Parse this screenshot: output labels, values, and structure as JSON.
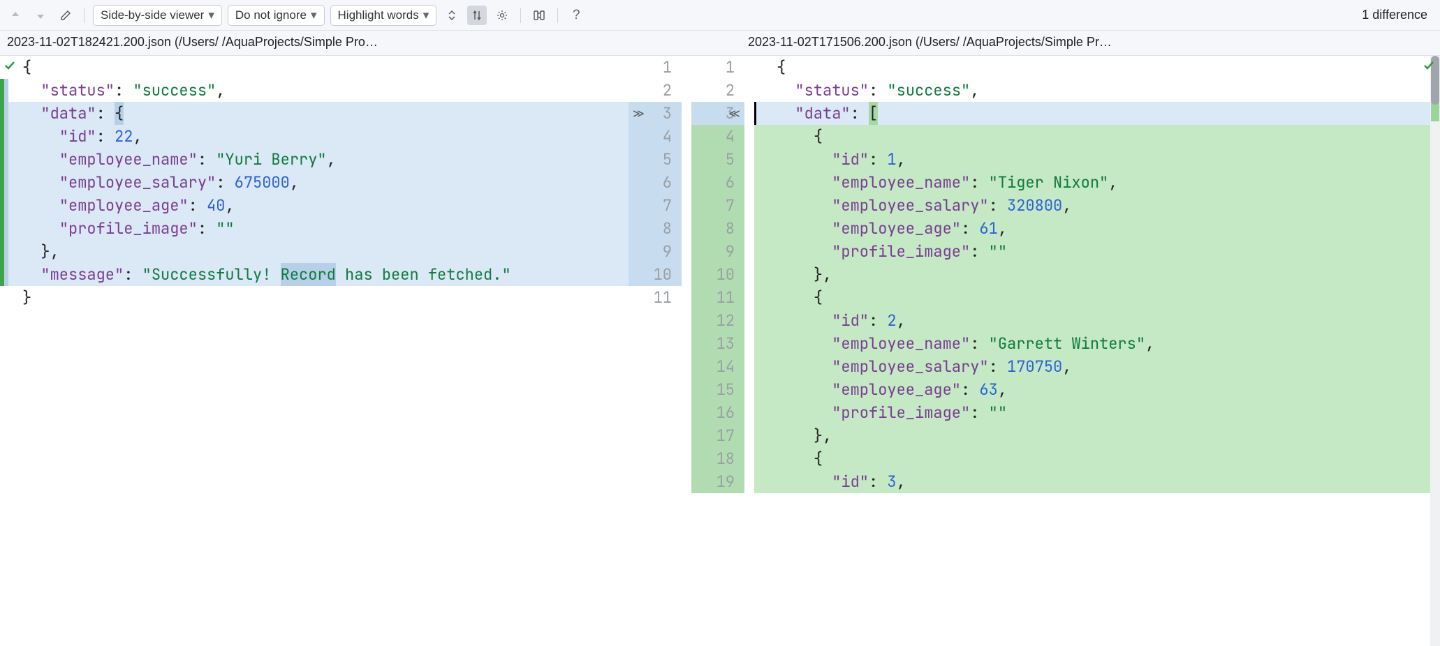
{
  "toolbar": {
    "view_mode": "Side-by-side viewer",
    "ignore_policy": "Do not ignore",
    "highlight_mode": "Highlight words",
    "diff_count": "1 difference"
  },
  "files": {
    "left": "2023-11-02T182421.200.json (/Users/            /AquaProjects/Simple Pro…",
    "right": "2023-11-02T171506.200.json (/Users/            /AquaProjects/Simple Pr…"
  },
  "left_lines": [
    {
      "n": 1,
      "bg": "",
      "tokens": [
        {
          "c": "tok-punc",
          "t": "{"
        }
      ]
    },
    {
      "n": 2,
      "bg": "",
      "tokens": [
        {
          "c": "",
          "t": "  "
        },
        {
          "c": "tok-key",
          "t": "\"status\""
        },
        {
          "c": "tok-punc",
          "t": ": "
        },
        {
          "c": "tok-str",
          "t": "\"success\""
        },
        {
          "c": "tok-punc",
          "t": ","
        }
      ]
    },
    {
      "n": 3,
      "bg": "bg-mod",
      "tokens": [
        {
          "c": "",
          "t": "  "
        },
        {
          "c": "tok-key",
          "t": "\"data\""
        },
        {
          "c": "tok-punc",
          "t": ": "
        },
        {
          "c": "tok-punc word-hl-old",
          "t": "{"
        }
      ]
    },
    {
      "n": 4,
      "bg": "bg-mod",
      "tokens": [
        {
          "c": "",
          "t": "    "
        },
        {
          "c": "tok-key",
          "t": "\"id\""
        },
        {
          "c": "tok-punc",
          "t": ": "
        },
        {
          "c": "tok-num",
          "t": "22"
        },
        {
          "c": "tok-punc",
          "t": ","
        }
      ]
    },
    {
      "n": 5,
      "bg": "bg-mod",
      "tokens": [
        {
          "c": "",
          "t": "    "
        },
        {
          "c": "tok-key",
          "t": "\"employee_name\""
        },
        {
          "c": "tok-punc",
          "t": ": "
        },
        {
          "c": "tok-str",
          "t": "\"Yuri Berry\""
        },
        {
          "c": "tok-punc",
          "t": ","
        }
      ]
    },
    {
      "n": 6,
      "bg": "bg-mod",
      "tokens": [
        {
          "c": "",
          "t": "    "
        },
        {
          "c": "tok-key",
          "t": "\"employee_salary\""
        },
        {
          "c": "tok-punc",
          "t": ": "
        },
        {
          "c": "tok-num",
          "t": "675000"
        },
        {
          "c": "tok-punc",
          "t": ","
        }
      ]
    },
    {
      "n": 7,
      "bg": "bg-mod",
      "tokens": [
        {
          "c": "",
          "t": "    "
        },
        {
          "c": "tok-key",
          "t": "\"employee_age\""
        },
        {
          "c": "tok-punc",
          "t": ": "
        },
        {
          "c": "tok-num",
          "t": "40"
        },
        {
          "c": "tok-punc",
          "t": ","
        }
      ]
    },
    {
      "n": 8,
      "bg": "bg-mod",
      "tokens": [
        {
          "c": "",
          "t": "    "
        },
        {
          "c": "tok-key",
          "t": "\"profile_image\""
        },
        {
          "c": "tok-punc",
          "t": ": "
        },
        {
          "c": "tok-str",
          "t": "\"\""
        }
      ]
    },
    {
      "n": 9,
      "bg": "bg-mod",
      "tokens": [
        {
          "c": "",
          "t": "  "
        },
        {
          "c": "tok-punc",
          "t": "},"
        }
      ]
    },
    {
      "n": 10,
      "bg": "bg-mod",
      "tokens": [
        {
          "c": "",
          "t": "  "
        },
        {
          "c": "tok-key",
          "t": "\"message\""
        },
        {
          "c": "tok-punc",
          "t": ": "
        },
        {
          "c": "tok-str",
          "t": "\"Successfully! "
        },
        {
          "c": "tok-str word-hl-old",
          "t": "Record"
        },
        {
          "c": "tok-str",
          "t": " has been fetched.\""
        }
      ]
    },
    {
      "n": 11,
      "bg": "",
      "tokens": [
        {
          "c": "tok-punc",
          "t": "}"
        }
      ]
    }
  ],
  "right_lines": [
    {
      "n": 1,
      "bg": "",
      "tokens": [
        {
          "c": "tok-punc",
          "t": "{"
        }
      ]
    },
    {
      "n": 2,
      "bg": "",
      "tokens": [
        {
          "c": "",
          "t": "  "
        },
        {
          "c": "tok-key",
          "t": "\"status\""
        },
        {
          "c": "tok-punc",
          "t": ": "
        },
        {
          "c": "tok-str",
          "t": "\"success\""
        },
        {
          "c": "tok-punc",
          "t": ","
        }
      ]
    },
    {
      "n": 3,
      "bg": "bg-mod",
      "tokens": [
        {
          "c": "",
          "t": "  "
        },
        {
          "c": "tok-key",
          "t": "\"data\""
        },
        {
          "c": "tok-punc",
          "t": ": "
        },
        {
          "c": "tok-punc word-hl-new",
          "t": "["
        }
      ]
    },
    {
      "n": 4,
      "bg": "bg-ins",
      "tokens": [
        {
          "c": "",
          "t": "    "
        },
        {
          "c": "tok-punc",
          "t": "{"
        }
      ]
    },
    {
      "n": 5,
      "bg": "bg-ins",
      "tokens": [
        {
          "c": "",
          "t": "      "
        },
        {
          "c": "tok-key",
          "t": "\"id\""
        },
        {
          "c": "tok-punc",
          "t": ": "
        },
        {
          "c": "tok-num",
          "t": "1"
        },
        {
          "c": "tok-punc",
          "t": ","
        }
      ]
    },
    {
      "n": 6,
      "bg": "bg-ins",
      "tokens": [
        {
          "c": "",
          "t": "      "
        },
        {
          "c": "tok-key",
          "t": "\"employee_name\""
        },
        {
          "c": "tok-punc",
          "t": ": "
        },
        {
          "c": "tok-str",
          "t": "\"Tiger Nixon\""
        },
        {
          "c": "tok-punc",
          "t": ","
        }
      ]
    },
    {
      "n": 7,
      "bg": "bg-ins",
      "tokens": [
        {
          "c": "",
          "t": "      "
        },
        {
          "c": "tok-key",
          "t": "\"employee_salary\""
        },
        {
          "c": "tok-punc",
          "t": ": "
        },
        {
          "c": "tok-num",
          "t": "320800"
        },
        {
          "c": "tok-punc",
          "t": ","
        }
      ]
    },
    {
      "n": 8,
      "bg": "bg-ins",
      "tokens": [
        {
          "c": "",
          "t": "      "
        },
        {
          "c": "tok-key",
          "t": "\"employee_age\""
        },
        {
          "c": "tok-punc",
          "t": ": "
        },
        {
          "c": "tok-num",
          "t": "61"
        },
        {
          "c": "tok-punc",
          "t": ","
        }
      ]
    },
    {
      "n": 9,
      "bg": "bg-ins",
      "tokens": [
        {
          "c": "",
          "t": "      "
        },
        {
          "c": "tok-key",
          "t": "\"profile_image\""
        },
        {
          "c": "tok-punc",
          "t": ": "
        },
        {
          "c": "tok-str",
          "t": "\"\""
        }
      ]
    },
    {
      "n": 10,
      "bg": "bg-ins",
      "tokens": [
        {
          "c": "",
          "t": "    "
        },
        {
          "c": "tok-punc",
          "t": "},"
        }
      ]
    },
    {
      "n": 11,
      "bg": "bg-ins",
      "tokens": [
        {
          "c": "",
          "t": "    "
        },
        {
          "c": "tok-punc",
          "t": "{"
        }
      ]
    },
    {
      "n": 12,
      "bg": "bg-ins",
      "tokens": [
        {
          "c": "",
          "t": "      "
        },
        {
          "c": "tok-key",
          "t": "\"id\""
        },
        {
          "c": "tok-punc",
          "t": ": "
        },
        {
          "c": "tok-num",
          "t": "2"
        },
        {
          "c": "tok-punc",
          "t": ","
        }
      ]
    },
    {
      "n": 13,
      "bg": "bg-ins",
      "tokens": [
        {
          "c": "",
          "t": "      "
        },
        {
          "c": "tok-key",
          "t": "\"employee_name\""
        },
        {
          "c": "tok-punc",
          "t": ": "
        },
        {
          "c": "tok-str",
          "t": "\"Garrett Winters\""
        },
        {
          "c": "tok-punc",
          "t": ","
        }
      ]
    },
    {
      "n": 14,
      "bg": "bg-ins",
      "tokens": [
        {
          "c": "",
          "t": "      "
        },
        {
          "c": "tok-key",
          "t": "\"employee_salary\""
        },
        {
          "c": "tok-punc",
          "t": ": "
        },
        {
          "c": "tok-num",
          "t": "170750"
        },
        {
          "c": "tok-punc",
          "t": ","
        }
      ]
    },
    {
      "n": 15,
      "bg": "bg-ins",
      "tokens": [
        {
          "c": "",
          "t": "      "
        },
        {
          "c": "tok-key",
          "t": "\"employee_age\""
        },
        {
          "c": "tok-punc",
          "t": ": "
        },
        {
          "c": "tok-num",
          "t": "63"
        },
        {
          "c": "tok-punc",
          "t": ","
        }
      ]
    },
    {
      "n": 16,
      "bg": "bg-ins",
      "tokens": [
        {
          "c": "",
          "t": "      "
        },
        {
          "c": "tok-key",
          "t": "\"profile_image\""
        },
        {
          "c": "tok-punc",
          "t": ": "
        },
        {
          "c": "tok-str",
          "t": "\"\""
        }
      ]
    },
    {
      "n": 17,
      "bg": "bg-ins",
      "tokens": [
        {
          "c": "",
          "t": "    "
        },
        {
          "c": "tok-punc",
          "t": "},"
        }
      ]
    },
    {
      "n": 18,
      "bg": "bg-ins",
      "tokens": [
        {
          "c": "",
          "t": "    "
        },
        {
          "c": "tok-punc",
          "t": "{"
        }
      ]
    },
    {
      "n": 19,
      "bg": "bg-ins",
      "tokens": [
        {
          "c": "",
          "t": "      "
        },
        {
          "c": "tok-key",
          "t": "\"id\""
        },
        {
          "c": "tok-punc",
          "t": ": "
        },
        {
          "c": "tok-num",
          "t": "3"
        },
        {
          "c": "tok-punc",
          "t": ","
        }
      ]
    }
  ],
  "left_gutter": [
    {
      "n": "1",
      "bg": ""
    },
    {
      "n": "2",
      "bg": ""
    },
    {
      "n": "3",
      "bg": "bg-mod-gut",
      "arrow": "right"
    },
    {
      "n": "4",
      "bg": "bg-mod-gut"
    },
    {
      "n": "5",
      "bg": "bg-mod-gut"
    },
    {
      "n": "6",
      "bg": "bg-mod-gut"
    },
    {
      "n": "7",
      "bg": "bg-mod-gut"
    },
    {
      "n": "8",
      "bg": "bg-mod-gut"
    },
    {
      "n": "9",
      "bg": "bg-mod-gut"
    },
    {
      "n": "10",
      "bg": "bg-mod-gut"
    },
    {
      "n": "11",
      "bg": ""
    }
  ],
  "right_gutter": [
    {
      "n": "1",
      "bg": ""
    },
    {
      "n": "2",
      "bg": ""
    },
    {
      "n": "3",
      "bg": "bg-mod-gut",
      "arrow": "left"
    },
    {
      "n": "4",
      "bg": "bg-ins-gut"
    },
    {
      "n": "5",
      "bg": "bg-ins-gut"
    },
    {
      "n": "6",
      "bg": "bg-ins-gut"
    },
    {
      "n": "7",
      "bg": "bg-ins-gut"
    },
    {
      "n": "8",
      "bg": "bg-ins-gut"
    },
    {
      "n": "9",
      "bg": "bg-ins-gut"
    },
    {
      "n": "10",
      "bg": "bg-ins-gut"
    },
    {
      "n": "11",
      "bg": "bg-ins-gut"
    },
    {
      "n": "12",
      "bg": "bg-ins-gut"
    },
    {
      "n": "13",
      "bg": "bg-ins-gut"
    },
    {
      "n": "14",
      "bg": "bg-ins-gut"
    },
    {
      "n": "15",
      "bg": "bg-ins-gut"
    },
    {
      "n": "16",
      "bg": "bg-ins-gut"
    },
    {
      "n": "17",
      "bg": "bg-ins-gut"
    },
    {
      "n": "18",
      "bg": "bg-ins-gut"
    },
    {
      "n": "19",
      "bg": "bg-ins-gut"
    }
  ]
}
